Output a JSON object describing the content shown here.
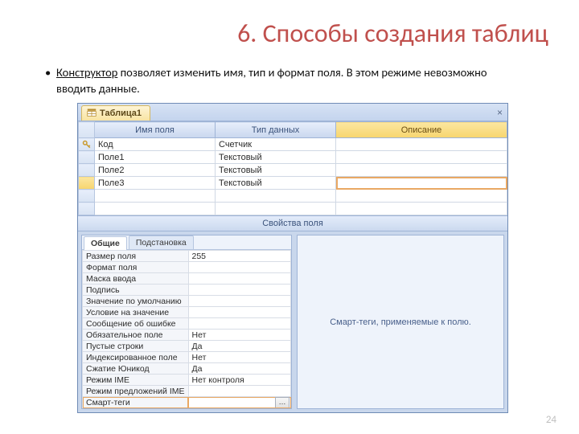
{
  "slide": {
    "title": "6. Способы создания таблиц",
    "bullet_lead": "Конструктор",
    "bullet_rest": " позволяет изменить имя, тип и формат поля. В этом режиме невозможно вводить данные.",
    "page_number": "24"
  },
  "app": {
    "tab_title": "Таблица1",
    "close_button": "×",
    "columns": {
      "name": "Имя поля",
      "type": "Тип данных",
      "desc": "Описание"
    },
    "rows": [
      {
        "name": "Код",
        "type": "Счетчик",
        "key": true,
        "selected": false
      },
      {
        "name": "Поле1",
        "type": "Текстовый",
        "key": false,
        "selected": false
      },
      {
        "name": "Поле2",
        "type": "Текстовый",
        "key": false,
        "selected": false
      },
      {
        "name": "Поле3",
        "type": "Текстовый",
        "key": false,
        "selected": true
      }
    ],
    "properties_header": "Свойства поля",
    "prop_tabs": {
      "general": "Общие",
      "lookup": "Подстановка"
    },
    "properties": [
      {
        "name": "Размер поля",
        "value": "255"
      },
      {
        "name": "Формат поля",
        "value": ""
      },
      {
        "name": "Маска ввода",
        "value": ""
      },
      {
        "name": "Подпись",
        "value": ""
      },
      {
        "name": "Значение по умолчанию",
        "value": ""
      },
      {
        "name": "Условие на значение",
        "value": ""
      },
      {
        "name": "Сообщение об ошибке",
        "value": ""
      },
      {
        "name": "Обязательное поле",
        "value": "Нет"
      },
      {
        "name": "Пустые строки",
        "value": "Да"
      },
      {
        "name": "Индексированное поле",
        "value": "Нет"
      },
      {
        "name": "Сжатие Юникод",
        "value": "Да"
      },
      {
        "name": "Режим IME",
        "value": "Нет контроля"
      },
      {
        "name": "Режим предложений IME",
        "value": ""
      },
      {
        "name": "Смарт-теги",
        "value": ""
      }
    ],
    "hint": "Смарт-теги, применяемые к полю."
  }
}
